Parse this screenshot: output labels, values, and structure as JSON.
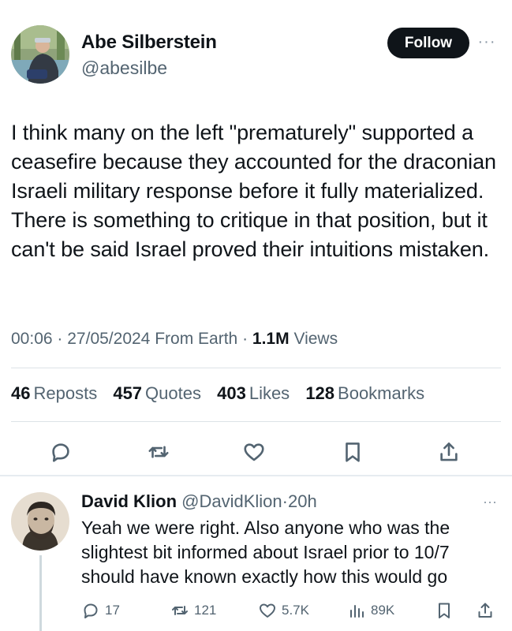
{
  "tweet": {
    "author_name": "Abe Silberstein",
    "author_handle": "@abesilbe",
    "follow_label": "Follow",
    "more_label": "···",
    "text": "I think many on the left \"prematurely\" supported a ceasefire because they accounted for the draconian Israeli military response before it fully materialized. There is something to critique in that position, but it can't be said Israel proved their intuitions mistaken.",
    "meta": {
      "time": "00:06",
      "date": "27/05/2024",
      "source": "From Earth",
      "views_count": "1.1M",
      "views_label": "Views",
      "sep": "·"
    },
    "stats": [
      {
        "count": "46",
        "label": "Reposts"
      },
      {
        "count": "457",
        "label": "Quotes"
      },
      {
        "count": "403",
        "label": "Likes"
      },
      {
        "count": "128",
        "label": "Bookmarks"
      }
    ],
    "action_icons": [
      "reply-icon",
      "repost-icon",
      "like-icon",
      "bookmark-icon",
      "share-icon"
    ]
  },
  "reply": {
    "author_name": "David Klion",
    "author_handle": "@DavidKlion",
    "sep": "·",
    "time": "20h",
    "more_label": "···",
    "text": "Yeah we were right. Also anyone who was the slightest bit informed about Israel prior to 10/7 should have known exactly how this would go",
    "actions": {
      "replies": "17",
      "reposts": "121",
      "likes": "5.7K",
      "views": "89K"
    }
  },
  "colors": {
    "text": "#0f1419",
    "secondary": "#536471",
    "follow_bg": "#0f1419",
    "divider": "#dde3e7"
  }
}
